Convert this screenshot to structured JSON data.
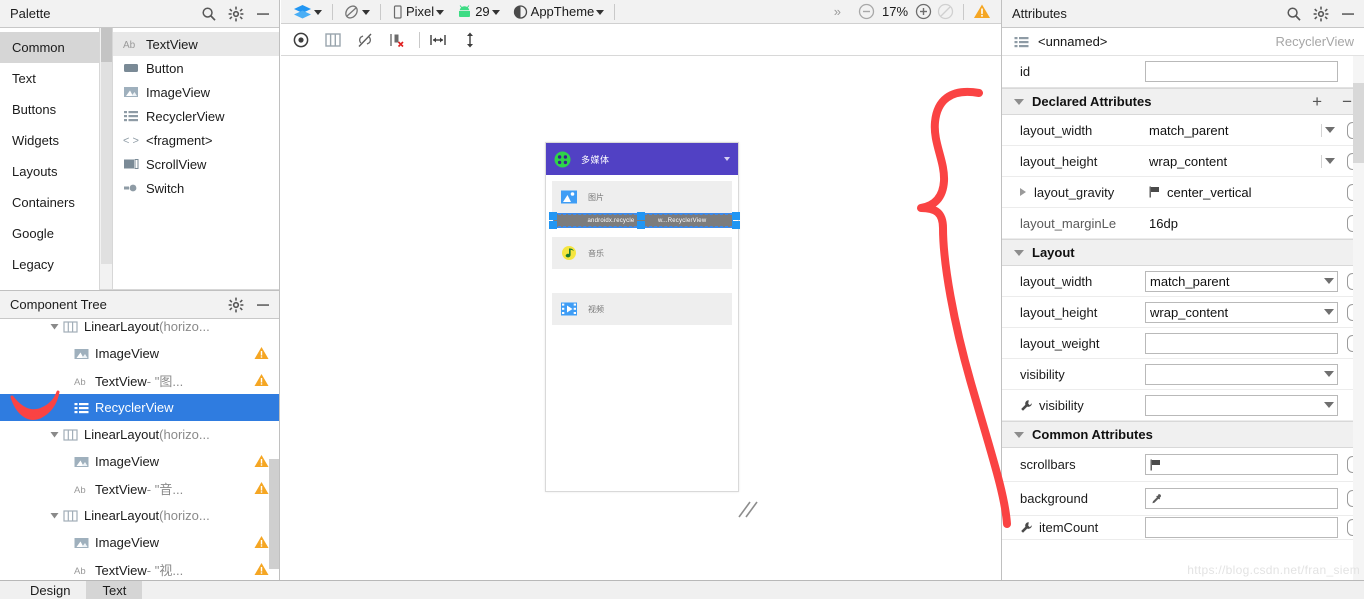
{
  "palette": {
    "title": "Palette",
    "icons": [
      "search-icon",
      "gear-icon",
      "minimize-icon"
    ],
    "categories": [
      {
        "label": "Common",
        "selected": true
      },
      {
        "label": "Text",
        "selected": false
      },
      {
        "label": "Buttons",
        "selected": false
      },
      {
        "label": "Widgets",
        "selected": false
      },
      {
        "label": "Layouts",
        "selected": false
      },
      {
        "label": "Containers",
        "selected": false
      },
      {
        "label": "Google",
        "selected": false
      },
      {
        "label": "Legacy",
        "selected": false
      }
    ],
    "items": [
      {
        "label": "TextView",
        "icon": "textview-icon",
        "selected": true
      },
      {
        "label": "Button",
        "icon": "button-icon",
        "selected": false
      },
      {
        "label": "ImageView",
        "icon": "imageview-icon",
        "selected": false
      },
      {
        "label": "RecyclerView",
        "icon": "recyclerview-icon",
        "selected": false
      },
      {
        "label": "<fragment>",
        "icon": "fragment-icon",
        "selected": false
      },
      {
        "label": "ScrollView",
        "icon": "scrollview-icon",
        "selected": false
      },
      {
        "label": "Switch",
        "icon": "switch-icon",
        "selected": false
      }
    ]
  },
  "component_tree": {
    "title": "Component Tree",
    "rows": [
      {
        "indent": 2,
        "twisty": "down",
        "icon": "linearlayout-icon",
        "label": "LinearLayout",
        "suffix": "(horizo...",
        "warning": false,
        "selected": false,
        "clipped_top": true
      },
      {
        "indent": 3,
        "twisty": "none",
        "icon": "imageview-icon",
        "label": "ImageView",
        "suffix": "",
        "warning": true,
        "selected": false
      },
      {
        "indent": 3,
        "twisty": "none",
        "icon": "textview-icon",
        "label": "TextView",
        "suffix": "- \"图...",
        "warning": true,
        "selected": false
      },
      {
        "indent": 2,
        "twisty": "none",
        "icon": "recyclerview-icon",
        "label": "RecyclerView",
        "suffix": "",
        "warning": false,
        "selected": true
      },
      {
        "indent": 2,
        "twisty": "down",
        "icon": "linearlayout-icon",
        "label": "LinearLayout",
        "suffix": "(horizo...",
        "warning": false,
        "selected": false
      },
      {
        "indent": 3,
        "twisty": "none",
        "icon": "imageview-icon",
        "label": "ImageView",
        "suffix": "",
        "warning": true,
        "selected": false
      },
      {
        "indent": 3,
        "twisty": "none",
        "icon": "textview-icon",
        "label": "TextView",
        "suffix": "- \"音...",
        "warning": true,
        "selected": false
      },
      {
        "indent": 2,
        "twisty": "down",
        "icon": "linearlayout-icon",
        "label": "LinearLayout",
        "suffix": "(horizo...",
        "warning": false,
        "selected": false
      },
      {
        "indent": 3,
        "twisty": "none",
        "icon": "imageview-icon",
        "label": "ImageView",
        "suffix": "",
        "warning": true,
        "selected": false
      },
      {
        "indent": 3,
        "twisty": "none",
        "icon": "textview-icon",
        "label": "TextView",
        "suffix": "- \"视...",
        "warning": true,
        "selected": false
      }
    ]
  },
  "toolbar": {
    "design_mode": "Design",
    "orientation": "Portrait",
    "device": "Pixel",
    "api_level": "29",
    "theme": "AppTheme",
    "overflow": "»",
    "zoom_out": "−",
    "zoom_value": "17%",
    "zoom_in": "+",
    "zoom_fit": "zoom-to-fit",
    "warning_count": ""
  },
  "toolbar2": {
    "buttons": [
      {
        "name": "show-hide-icon"
      },
      {
        "name": "blueprint-columns-icon"
      },
      {
        "name": "turn-off-autoconnect-icon"
      },
      {
        "name": "clear-constraints-icon"
      },
      {
        "name": "horizontal-margin-icon"
      },
      {
        "name": "vertical-expand-icon"
      }
    ]
  },
  "preview": {
    "app_bar_title": "多媒体",
    "app_bar_color": "#5141c4",
    "logo_color": "#2fd44a",
    "rows": [
      {
        "label": "图片",
        "icon": "picture-icon",
        "color": "#3f9df5"
      },
      {
        "label": "音乐",
        "icon": "music-icon",
        "color": "#f5e53f"
      },
      {
        "label": "视频",
        "icon": "video-icon",
        "color": "#3f9df5"
      }
    ],
    "selection": {
      "left_text": "androidx.recycle",
      "right_text": "w...RecyclerView",
      "handle_color": "#2196f3"
    }
  },
  "attributes": {
    "title": "Attributes",
    "component_name": "<unnamed>",
    "component_type": "RecyclerView",
    "id_label": "id",
    "id_value": "",
    "sections": [
      {
        "title": "Declared Attributes",
        "has_add_remove": true,
        "add_label": "+",
        "remove_label": "−",
        "rows": [
          {
            "key": "layout_width",
            "value": "match_parent",
            "dropdown": true,
            "flat": true,
            "picker": true
          },
          {
            "key": "layout_height",
            "value": "wrap_content",
            "dropdown": true,
            "flat": true,
            "picker": true
          },
          {
            "key": "layout_gravity",
            "value": "center_vertical",
            "dropdown": false,
            "flat": true,
            "picker": true,
            "expander": true,
            "flag": true
          },
          {
            "key": "layout_marginLe",
            "value": "16dp",
            "dropdown": false,
            "flat": true,
            "picker": true
          }
        ]
      },
      {
        "title": "Layout",
        "has_add_remove": false,
        "rows": [
          {
            "key": "layout_width",
            "value": "match_parent",
            "dropdown": true,
            "flat": false,
            "picker": true
          },
          {
            "key": "layout_height",
            "value": "wrap_content",
            "dropdown": true,
            "flat": false,
            "picker": true
          },
          {
            "key": "layout_weight",
            "value": "",
            "dropdown": false,
            "flat": false,
            "picker": true
          },
          {
            "key": "visibility",
            "value": "",
            "dropdown": true,
            "flat": false,
            "picker": false
          },
          {
            "key": "visibility",
            "value": "",
            "dropdown": true,
            "flat": false,
            "picker": false,
            "wrench": true
          }
        ]
      },
      {
        "title": "Common Attributes",
        "has_add_remove": false,
        "rows": [
          {
            "key": "scrollbars",
            "value": "",
            "dropdown": false,
            "flat": false,
            "picker": true,
            "flag": true
          },
          {
            "key": "background",
            "value": "",
            "dropdown": false,
            "flat": false,
            "picker": true,
            "eyedropper": true
          },
          {
            "key": "itemCount",
            "value": "",
            "dropdown": false,
            "flat": false,
            "picker": true,
            "wrench": true
          }
        ]
      }
    ]
  },
  "bottom_tabs": [
    {
      "label": "Design",
      "selected": false
    },
    {
      "label": "Text",
      "selected": true
    }
  ],
  "watermark": "https://blog.csdn.net/fran_siem"
}
